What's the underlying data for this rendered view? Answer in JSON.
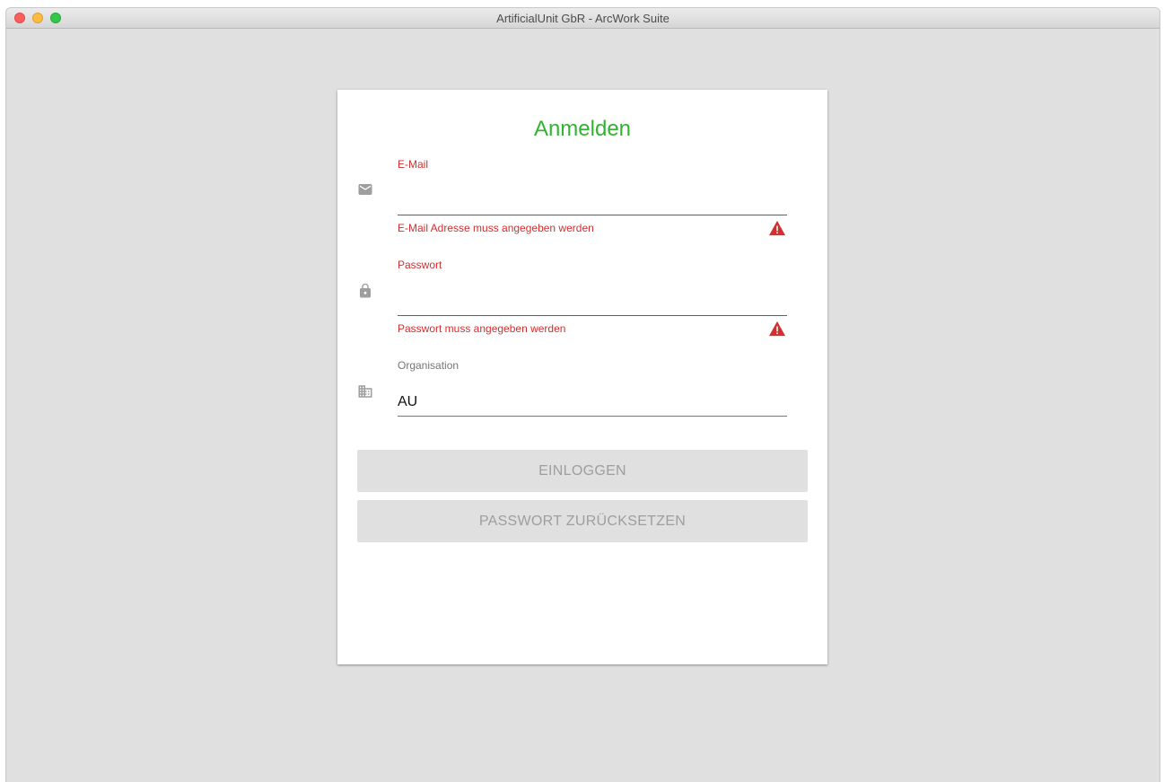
{
  "window": {
    "title": "ArtificialUnit GbR - ArcWork Suite"
  },
  "login": {
    "title": "Anmelden",
    "email": {
      "label": "E-Mail",
      "value": "",
      "error": "E-Mail Adresse muss angegeben werden",
      "icon": "email-icon"
    },
    "password": {
      "label": "Passwort",
      "value": "",
      "error": "Passwort muss angegeben werden",
      "icon": "lock-icon"
    },
    "organisation": {
      "label": "Organisation",
      "value": "AU",
      "icon": "building-icon"
    },
    "buttons": {
      "login": "EINLOGGEN",
      "reset": "PASSWORT ZURÜCKSETZEN"
    }
  },
  "colors": {
    "accent": "#33b233",
    "error": "#d32f2f",
    "icon": "#9e9e9e",
    "button_bg": "#e0e0e0",
    "button_text": "#9e9e9e",
    "background": "#e0e0e0"
  }
}
